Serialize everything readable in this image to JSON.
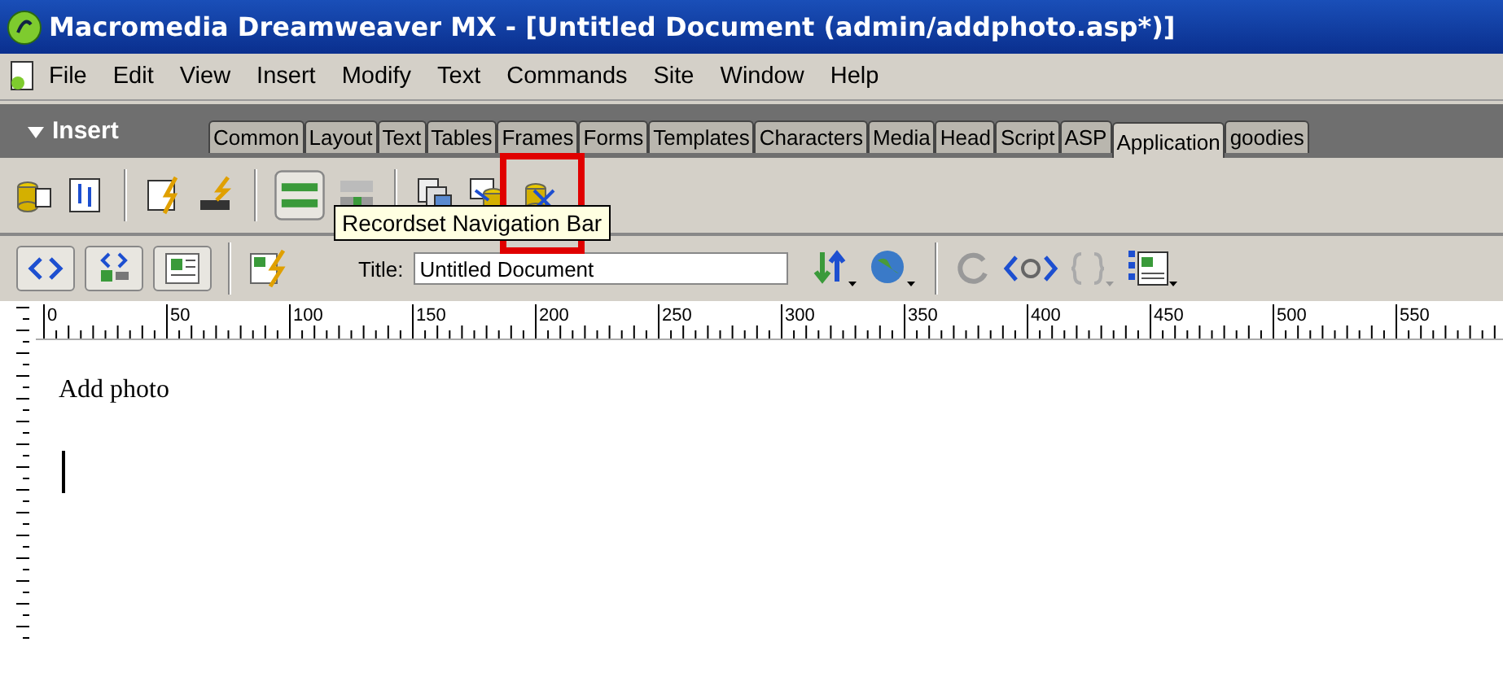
{
  "window": {
    "title": "Macromedia Dreamweaver MX - [Untitled Document (admin/addphoto.asp*)]"
  },
  "menu": [
    "File",
    "Edit",
    "View",
    "Insert",
    "Modify",
    "Text",
    "Commands",
    "Site",
    "Window",
    "Help"
  ],
  "insert_bar": {
    "title": "Insert",
    "tabs": [
      {
        "label": "Common",
        "selected": false
      },
      {
        "label": "Layout",
        "selected": false
      },
      {
        "label": "Text",
        "selected": false
      },
      {
        "label": "Tables",
        "selected": false
      },
      {
        "label": "Frames",
        "selected": false
      },
      {
        "label": "Forms",
        "selected": false
      },
      {
        "label": "Templates",
        "selected": false
      },
      {
        "label": "Characters",
        "selected": false
      },
      {
        "label": "Media",
        "selected": false
      },
      {
        "label": "Head",
        "selected": false
      },
      {
        "label": "Script",
        "selected": false
      },
      {
        "label": "ASP",
        "selected": false
      },
      {
        "label": "Application",
        "selected": true
      },
      {
        "label": "goodies",
        "selected": false
      }
    ]
  },
  "tooltip": "Recordset Navigation Bar",
  "document_toolbar": {
    "title_label": "Title:",
    "title_value": "Untitled Document"
  },
  "ruler": {
    "marks": [
      "0",
      "50",
      "100",
      "150",
      "200",
      "250",
      "300",
      "350",
      "400",
      "450",
      "500",
      "550"
    ]
  },
  "document": {
    "text": "Add photo"
  }
}
